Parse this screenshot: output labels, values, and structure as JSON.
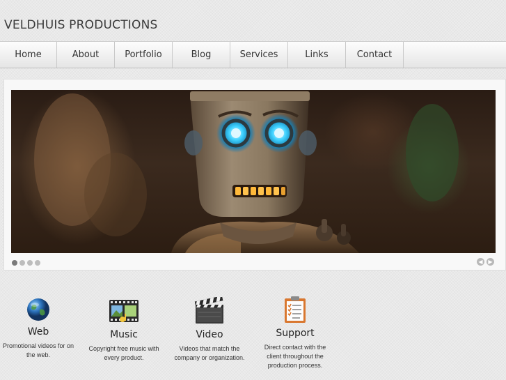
{
  "site": {
    "title": "VELDHUIS PRODUCTIONS"
  },
  "nav": {
    "items": [
      {
        "label": "Home"
      },
      {
        "label": "About"
      },
      {
        "label": "Portfolio"
      },
      {
        "label": "Blog"
      },
      {
        "label": "Services"
      },
      {
        "label": "Links"
      },
      {
        "label": "Contact"
      }
    ]
  },
  "slider": {
    "slide_count": 4,
    "active_index": 0,
    "prev_icon": "chevron-left-icon",
    "next_icon": "chevron-right-icon"
  },
  "features": [
    {
      "icon": "globe-icon",
      "title": "Web",
      "description": "Promotional videos for on the web."
    },
    {
      "icon": "film-strip-icon",
      "title": "Music",
      "description": "Copyright free music with every product."
    },
    {
      "icon": "clapperboard-icon",
      "title": "Video",
      "description": "Videos that match the company or organization."
    },
    {
      "icon": "clipboard-icon",
      "title": "Support",
      "description": "Direct contact with the client throughout the production process."
    }
  ],
  "colors": {
    "background": "#e9e9e9",
    "robot_eye": "#27c6ff",
    "robot_mouth": "#ffb93a"
  }
}
